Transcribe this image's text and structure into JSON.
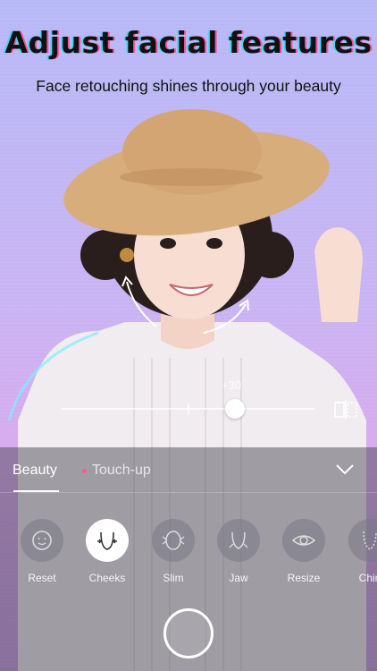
{
  "header": {
    "title": "Adjust facial features",
    "subtitle": "Face retouching shines through your beauty"
  },
  "slider": {
    "value_label": "+30",
    "level_percent": 65
  },
  "tabs": [
    {
      "label": "Beauty",
      "active": true
    },
    {
      "label": "Touch-up",
      "active": false
    }
  ],
  "tools": [
    {
      "label": "Reset",
      "icon": "reset-face-icon"
    },
    {
      "label": "Cheeks",
      "icon": "cheeks-icon",
      "active": true
    },
    {
      "label": "Slim",
      "icon": "slim-face-icon"
    },
    {
      "label": "Jaw",
      "icon": "jaw-icon"
    },
    {
      "label": "Resize",
      "icon": "eye-resize-icon"
    },
    {
      "label": "Chin",
      "icon": "chin-icon"
    }
  ],
  "colors": {
    "accent_dot": "#ff5a8c",
    "background_top": "#b7b9f6",
    "background_bottom": "#c79be2"
  }
}
